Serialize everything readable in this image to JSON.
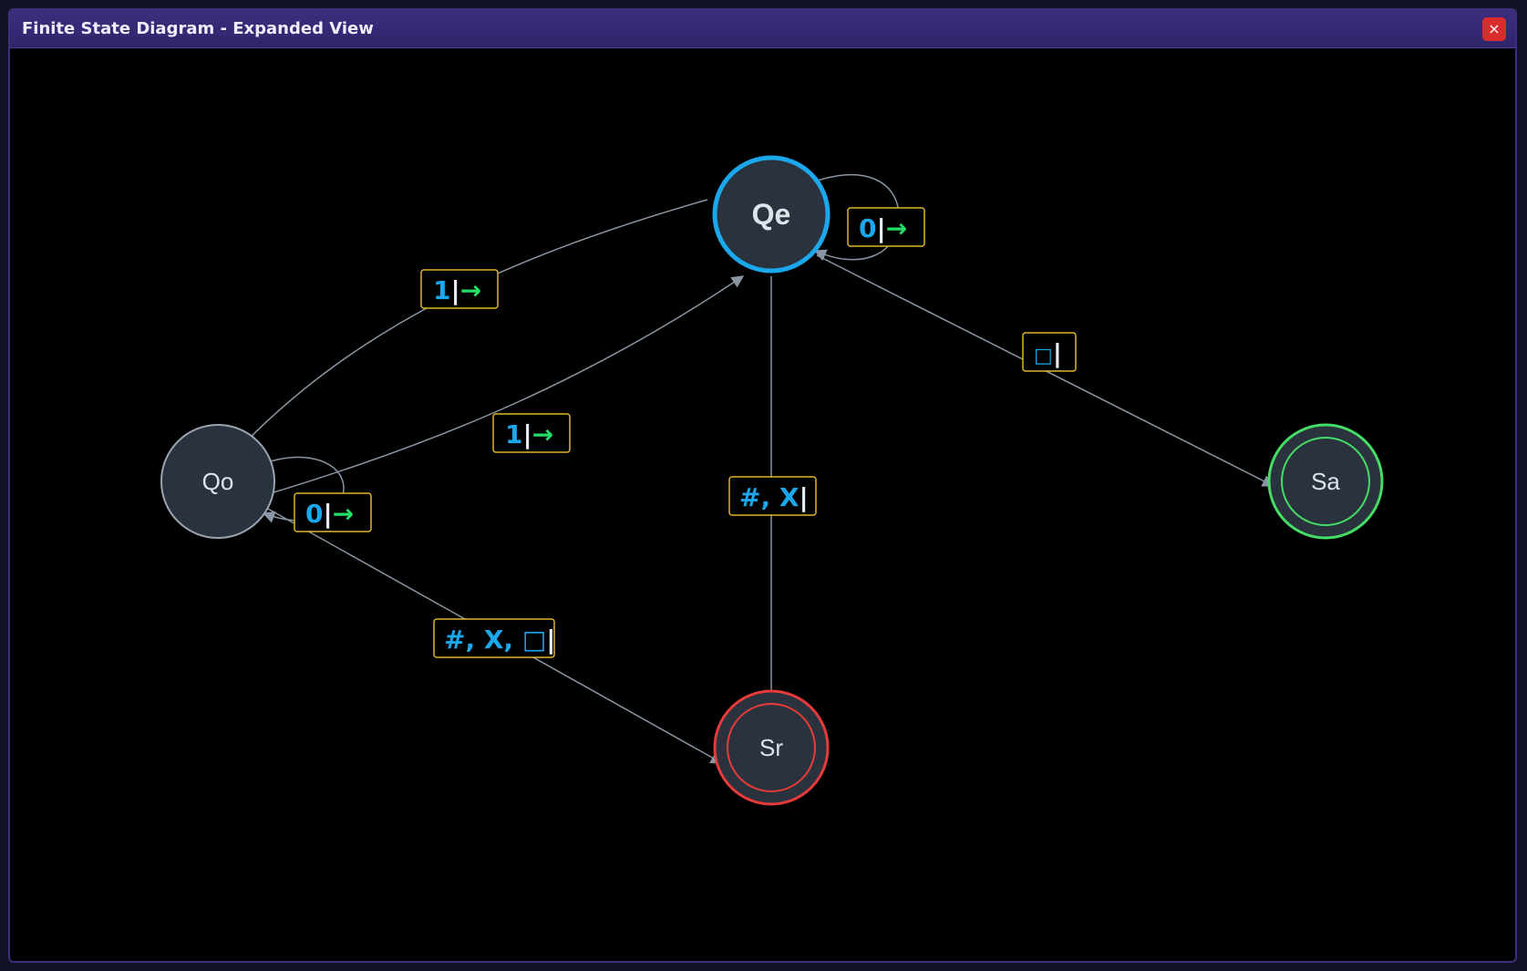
{
  "window": {
    "title": "Finite State Diagram - Expanded View",
    "close_label": "×"
  },
  "colors": {
    "symbol": "#1aa7ec",
    "move": "#22dd66",
    "separator": "#e8eef5",
    "label_border": "#e0b52a",
    "edge": "#8a96a3",
    "state_fill": "#2a333d",
    "state_stroke": "#9aa5b1",
    "current_stroke": "#1aa7ec",
    "accept_stroke": "#44dd66",
    "reject_stroke": "#e83a3a"
  },
  "states": [
    {
      "id": "Qe",
      "label": "Qe",
      "kind": "current"
    },
    {
      "id": "Qo",
      "label": "Qo",
      "kind": "normal"
    },
    {
      "id": "Sa",
      "label": "Sa",
      "kind": "accept"
    },
    {
      "id": "Sr",
      "label": "Sr",
      "kind": "reject"
    }
  ],
  "transitions": [
    {
      "from": "Qe",
      "to": "Qe",
      "symbols": "0",
      "move": "→"
    },
    {
      "from": "Qe",
      "to": "Qo",
      "symbols": "1",
      "move": "→"
    },
    {
      "from": "Qo",
      "to": "Qe",
      "symbols": "1",
      "move": "→"
    },
    {
      "from": "Qo",
      "to": "Qo",
      "symbols": "0",
      "move": "→"
    },
    {
      "from": "Qe",
      "to": "Sa",
      "symbols": "□",
      "move": ""
    },
    {
      "from": "Qe",
      "to": "Sr",
      "symbols": "#, X",
      "move": ""
    },
    {
      "from": "Qo",
      "to": "Sr",
      "symbols": "#, X, □",
      "move": ""
    }
  ]
}
